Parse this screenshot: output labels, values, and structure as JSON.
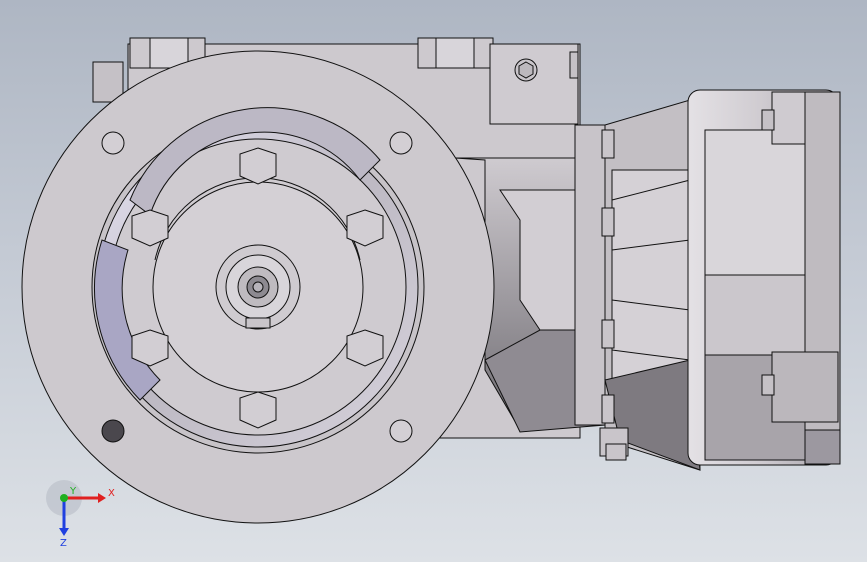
{
  "viewport": {
    "background_top": "#aeb6c3",
    "background_bottom": "#dde1e6"
  },
  "model": {
    "shade_light": "#d9d5d9",
    "shade_mid": "#bbb7bb",
    "shade_dark": "#8f8b90",
    "shade_highlight": "#dcd9ea",
    "edge_color": "#101010"
  },
  "triad": {
    "x_label": "X",
    "y_label": "Y",
    "z_label": "Z",
    "x_color": "#e02020",
    "y_color": "#20b020",
    "z_color": "#2040e0"
  }
}
